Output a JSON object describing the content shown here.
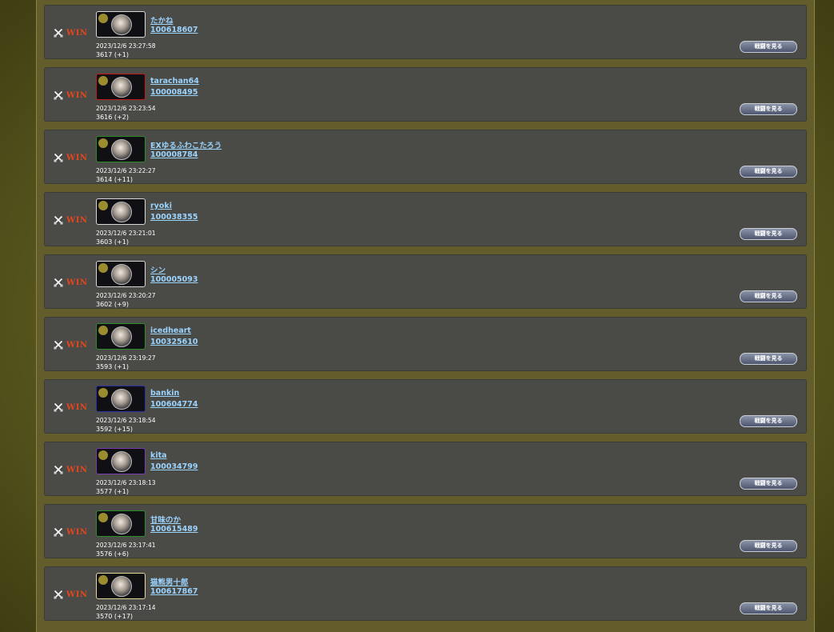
{
  "colors": {
    "win": "#e4471d",
    "link": "#9bd4ff",
    "row_bg": "#4a4a46",
    "page_bg": "#625d2b"
  },
  "battles": [
    {
      "result": "WIN",
      "name": "たかね",
      "id": "100618607",
      "time": "2023/12/6 23:27:58",
      "score": "3617 (+1)",
      "button": "戦闘を見る",
      "avatar_border": "white"
    },
    {
      "result": "WIN",
      "name": "tarachan64",
      "id": "100008495",
      "time": "2023/12/6 23:23:54",
      "score": "3616 (+2)",
      "button": "戦闘を見る",
      "avatar_border": "red"
    },
    {
      "result": "WIN",
      "name": "EXゆるふわこたろう",
      "id": "100008784",
      "time": "2023/12/6 23:22:27",
      "score": "3614 (+11)",
      "button": "戦闘を見る",
      "avatar_border": "green"
    },
    {
      "result": "WIN",
      "name": "ryoki",
      "id": "100038355",
      "time": "2023/12/6 23:21:01",
      "score": "3603 (+1)",
      "button": "戦闘を見る",
      "avatar_border": "white"
    },
    {
      "result": "WIN",
      "name": "シン",
      "id": "100005093",
      "time": "2023/12/6 23:20:27",
      "score": "3602 (+9)",
      "button": "戦闘を見る",
      "avatar_border": "white"
    },
    {
      "result": "WIN",
      "name": "icedheart",
      "id": "100325610",
      "time": "2023/12/6 23:19:27",
      "score": "3593 (+1)",
      "button": "戦闘を見る",
      "avatar_border": "green"
    },
    {
      "result": "WIN",
      "name": "bankin",
      "id": "100604774",
      "time": "2023/12/6 23:18:54",
      "score": "3592 (+15)",
      "button": "戦闘を見る",
      "avatar_border": "blue"
    },
    {
      "result": "WIN",
      "name": "kita",
      "id": "100034799",
      "time": "2023/12/6 23:18:13",
      "score": "3577 (+1)",
      "button": "戦闘を見る",
      "avatar_border": "purple"
    },
    {
      "result": "WIN",
      "name": "甘味のか",
      "id": "100615489",
      "time": "2023/12/6 23:17:41",
      "score": "3576 (+6)",
      "button": "戦闘を見る",
      "avatar_border": "green"
    },
    {
      "result": "WIN",
      "name": "猫熊男十郎",
      "id": "100617867",
      "time": "2023/12/6 23:17:14",
      "score": "3570 (+17)",
      "button": "戦闘を見る",
      "avatar_border": "gold"
    }
  ]
}
